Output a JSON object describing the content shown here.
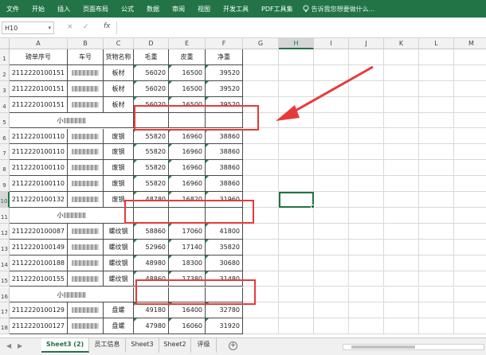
{
  "ribbon": {
    "tabs": [
      "文件",
      "开始",
      "插入",
      "页面布局",
      "公式",
      "数据",
      "审阅",
      "视图",
      "开发工具",
      "PDF工具集"
    ],
    "tell_me": "告诉我您想要做什么..."
  },
  "formula_bar": {
    "name_box": "H10",
    "cancel": "×",
    "enter": "✓",
    "fx": "fx",
    "value": ""
  },
  "columns": [
    "A",
    "B",
    "C",
    "D",
    "E",
    "F",
    "G",
    "H",
    "I",
    "J",
    "K",
    "L",
    "M"
  ],
  "selected_column": "H",
  "selected_row": "10",
  "header_row": {
    "row": "1",
    "cells": [
      "磅单序号",
      "车号",
      "货物名称",
      "毛重",
      "皮重",
      "净重"
    ]
  },
  "rows": [
    {
      "row": "2",
      "a": "2112220100151",
      "c": "板材",
      "d": "56020",
      "e": "16500",
      "f": "39520",
      "plate": true
    },
    {
      "row": "3",
      "a": "2112220100151",
      "c": "板材",
      "d": "56020",
      "e": "16500",
      "f": "39520",
      "plate": true
    },
    {
      "row": "4",
      "a": "2112220100151",
      "c": "板材",
      "d": "56020",
      "e": "16500",
      "f": "39520",
      "plate": true
    },
    {
      "row": "5",
      "subtotal": "小",
      "plate": false
    },
    {
      "row": "6",
      "a": "2112220100110",
      "c": "废钢",
      "d": "55820",
      "e": "16960",
      "f": "38860",
      "plate": true
    },
    {
      "row": "7",
      "a": "2112220100110",
      "c": "废钢",
      "d": "55820",
      "e": "16960",
      "f": "38860",
      "plate": true
    },
    {
      "row": "8",
      "a": "2112220100110",
      "c": "废钢",
      "d": "55820",
      "e": "16960",
      "f": "38860",
      "plate": true
    },
    {
      "row": "9",
      "a": "2112220100110",
      "c": "废钢",
      "d": "55820",
      "e": "16960",
      "f": "38860",
      "plate": true
    },
    {
      "row": "10",
      "a": "2112220100132",
      "c": "废钢",
      "d": "48780",
      "e": "16820",
      "f": "31960",
      "plate": true
    },
    {
      "row": "11",
      "subtotal": "小",
      "plate": false
    },
    {
      "row": "12",
      "a": "2112220100087",
      "c": "螺纹钢",
      "d": "58860",
      "e": "17060",
      "f": "41800",
      "plate": true
    },
    {
      "row": "13",
      "a": "2112220100149",
      "c": "螺纹钢",
      "d": "52960",
      "e": "17140",
      "f": "35820",
      "plate": true
    },
    {
      "row": "14",
      "a": "2112220100188",
      "c": "螺纹钢",
      "d": "48980",
      "e": "18300",
      "f": "30680",
      "plate": true
    },
    {
      "row": "15",
      "a": "2112220100155",
      "c": "螺纹钢",
      "d": "48860",
      "e": "17380",
      "f": "31480",
      "plate": true
    },
    {
      "row": "16",
      "subtotal": "小",
      "plate": false
    },
    {
      "row": "17",
      "a": "2112220100129",
      "c": "盘螺",
      "d": "49180",
      "e": "16400",
      "f": "32780",
      "plate": true
    },
    {
      "row": "18",
      "a": "2112220100127",
      "c": "盘螺",
      "d": "47980",
      "e": "16060",
      "f": "31920",
      "plate": true
    }
  ],
  "sheets": [
    "Sheet3 (2)",
    "员工信息",
    "Sheet3",
    "Sheet2",
    "评级"
  ],
  "active_sheet": "Sheet3 (2)",
  "add_sheet": "+",
  "annotation_color": "#e63a3a",
  "accent_color": "#217346"
}
